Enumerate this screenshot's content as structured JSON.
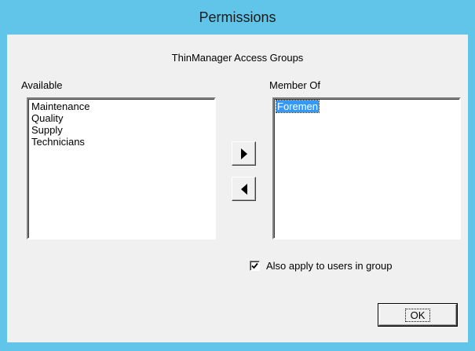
{
  "window": {
    "title": "Permissions"
  },
  "dialog": {
    "group_title": "ThinManager Access Groups",
    "available": {
      "label": "Available",
      "items": [
        "Maintenance",
        "Quality",
        "Supply",
        "Technicians"
      ]
    },
    "member_of": {
      "label": "Member Of",
      "items": [
        "Foremen"
      ],
      "selected": "Foremen"
    },
    "buttons": {
      "add_icon": "right-arrow-icon",
      "remove_icon": "left-arrow-icon",
      "ok_label": "OK"
    },
    "apply_to_users": {
      "label": "Also apply to users in group",
      "checked": true
    }
  }
}
